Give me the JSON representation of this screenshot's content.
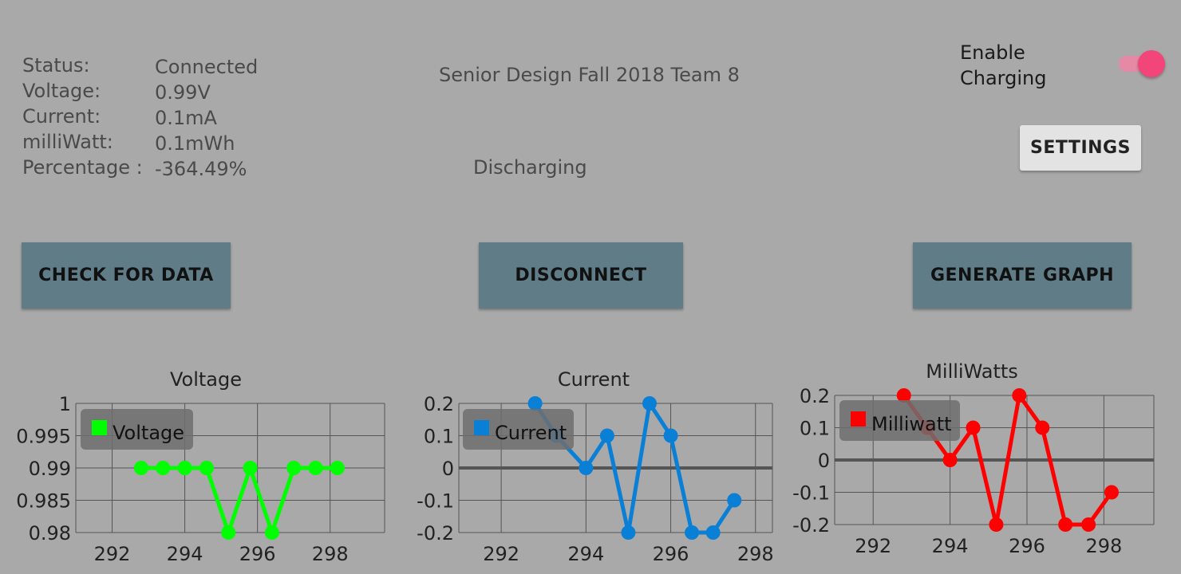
{
  "status": {
    "rows": [
      {
        "label": "Status:",
        "value": "Connected"
      },
      {
        "label": "Voltage:",
        "value": "0.99V"
      },
      {
        "label": "Current:",
        "value": "0.1mA"
      },
      {
        "label": "milliWatt:",
        "value": "0.1mWh"
      },
      {
        "label": "Percentage :",
        "value": "-364.49%"
      }
    ]
  },
  "header": {
    "title": "Senior Design Fall 2018 Team 8",
    "charge_state": "Discharging"
  },
  "charging_toggle": {
    "label_line1": "Enable",
    "label_line2": "Charging",
    "on": true,
    "color": "#f2457a"
  },
  "buttons": {
    "settings": "SETTINGS",
    "check_for_data": "CHECK FOR DATA",
    "disconnect": "DISCONNECT",
    "generate_graph": "GENERATE GRAPH"
  },
  "chart_data": [
    {
      "type": "line",
      "title": "Voltage",
      "legend": "Voltage",
      "color": "#00ff00",
      "xlim": [
        291,
        299.5
      ],
      "ylim": [
        0.98,
        1.0
      ],
      "xticks": [
        292,
        294,
        296,
        298
      ],
      "yticks": [
        0.98,
        0.985,
        0.99,
        0.995,
        1
      ],
      "ytick_labels": [
        "0.98",
        "0.985",
        "0.99",
        "0.995",
        "1"
      ],
      "zero_line": false,
      "series": [
        {
          "name": "Voltage",
          "x": [
            292.8,
            293.4,
            294.0,
            294.6,
            295.2,
            295.8,
            296.4,
            297.0,
            297.6,
            298.2
          ],
          "y": [
            0.99,
            0.99,
            0.99,
            0.99,
            0.98,
            0.99,
            0.98,
            0.99,
            0.99,
            0.99
          ]
        }
      ]
    },
    {
      "type": "line",
      "title": "Current",
      "legend": "Current",
      "color": "#0a7fd6",
      "xlim": [
        291,
        298.4
      ],
      "ylim": [
        -0.2,
        0.2
      ],
      "xticks": [
        292,
        294,
        296,
        298
      ],
      "yticks": [
        -0.2,
        -0.1,
        0,
        0.1,
        0.2
      ],
      "ytick_labels": [
        "-0.2",
        "-0.1",
        "0",
        "0.1",
        "0.2"
      ],
      "zero_line": true,
      "series": [
        {
          "name": "Current",
          "x": [
            292.8,
            293.3,
            294.0,
            294.5,
            295.0,
            295.5,
            296.0,
            296.5,
            297.0,
            297.5
          ],
          "y": [
            0.2,
            0.1,
            0.0,
            0.1,
            -0.2,
            0.2,
            0.1,
            -0.2,
            -0.2,
            -0.1
          ]
        }
      ]
    },
    {
      "type": "line",
      "title": "MilliWatts",
      "legend": "Milliwatt",
      "color": "#ff0000",
      "xlim": [
        291,
        299.3
      ],
      "ylim": [
        -0.2,
        0.2
      ],
      "xticks": [
        292,
        294,
        296,
        298
      ],
      "yticks": [
        -0.2,
        -0.1,
        0,
        0.1,
        0.2
      ],
      "ytick_labels": [
        "-0.2",
        "-0.1",
        "0",
        "0.1",
        "0.2"
      ],
      "zero_line": true,
      "series": [
        {
          "name": "Milliwatt",
          "x": [
            292.8,
            293.4,
            294.0,
            294.6,
            295.2,
            295.8,
            296.4,
            297.0,
            297.6,
            298.2
          ],
          "y": [
            0.2,
            0.1,
            0.0,
            0.1,
            -0.2,
            0.2,
            0.1,
            -0.2,
            -0.2,
            -0.1
          ]
        }
      ]
    }
  ]
}
